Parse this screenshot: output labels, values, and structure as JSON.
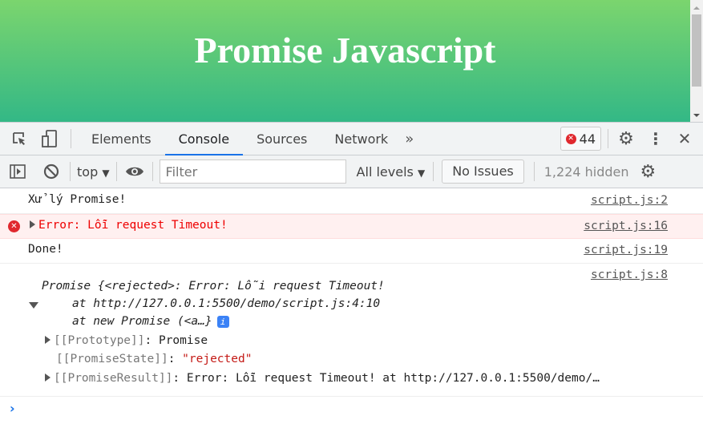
{
  "page": {
    "title": "Promise Javascript",
    "gradient": [
      "#7bd56e",
      "#33b886"
    ]
  },
  "devtools": {
    "tabs": [
      {
        "label": "Elements"
      },
      {
        "label": "Console"
      },
      {
        "label": "Sources"
      },
      {
        "label": "Network"
      }
    ],
    "active_tab": "Console",
    "error_count": "44",
    "toolbar": {
      "context": "top",
      "filter_placeholder": "Filter",
      "levels": "All levels",
      "issues": "No Issues",
      "hidden": "1,224 hidden"
    }
  },
  "console": {
    "messages": [
      {
        "text": "Xử lý Promise!",
        "source": "script.js:2",
        "level": "log"
      },
      {
        "text": "Error: Lỗi request Timeout!",
        "source": "script.js:16",
        "level": "error"
      },
      {
        "text": "Done!",
        "source": "script.js:19",
        "level": "log"
      }
    ],
    "object": {
      "source": "script.js:8",
      "line1": "Promise {<rejected>: Error: Lỗi request Timeout!",
      "line2": "at http://127.0.0.1:5500/demo/script.js:4:10",
      "line3": "at new Promise (<a…}",
      "prototype_key": "[[Prototype]]",
      "prototype_val": ": Promise",
      "state_key": "[[PromiseState]]",
      "state_val": "\"rejected\"",
      "result_key": "[[PromiseResult]]",
      "result_val": ": Error: Lỗi request Timeout! at http://127.0.0.1:5500/demo/…"
    }
  }
}
